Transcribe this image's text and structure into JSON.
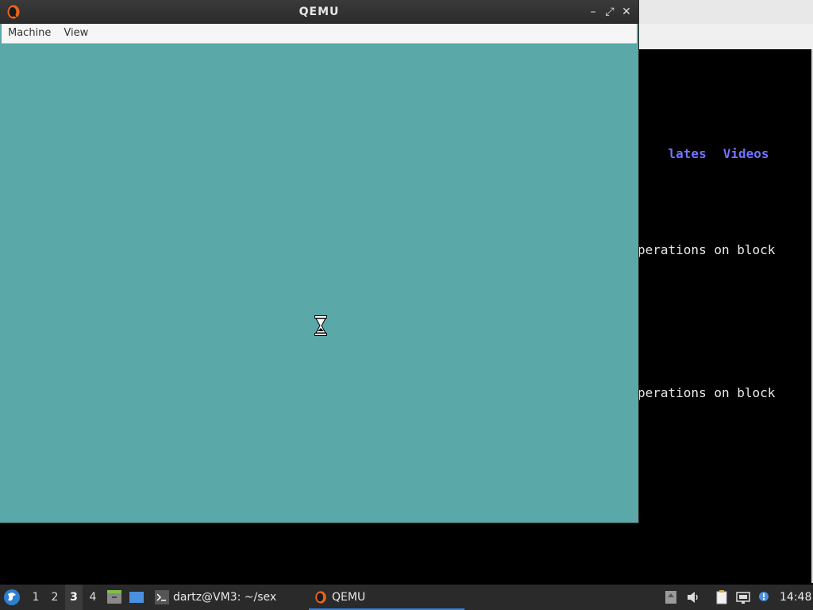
{
  "background_terminal": {
    "lines": [
      {
        "kind": "dirs",
        "items": [
          "lates",
          "Videos"
        ]
      },
      {
        "kind": "text",
        "text": "perations on block"
      },
      {
        "kind": "text",
        "text": "perations on block"
      }
    ]
  },
  "qemu_window": {
    "title": "QEMU",
    "menu": [
      "Machine",
      "View"
    ],
    "display_color": "#5aa8a8",
    "controls": {
      "minimize": "–",
      "maximize": "⤢",
      "close": "✕"
    }
  },
  "taskbar": {
    "workspaces": [
      "1",
      "2",
      "3",
      "4"
    ],
    "active_workspace": "3",
    "launchers": [
      "file-manager-icon",
      "desktop-icon"
    ],
    "tasks": [
      {
        "label": "dartz@VM3: ~/sex",
        "icon": "terminal-icon",
        "active": false
      },
      {
        "label": "QEMU",
        "icon": "qemu-icon",
        "active": true
      }
    ],
    "tray_icons": [
      "updates-icon",
      "volume-icon",
      "clipboard-icon",
      "network-icon",
      "notification-icon"
    ],
    "clock": "14:48"
  },
  "colors": {
    "accent": "#3a7fd0",
    "directory_text": "#7272ff",
    "taskbar_bg": "#2a2a2a"
  }
}
